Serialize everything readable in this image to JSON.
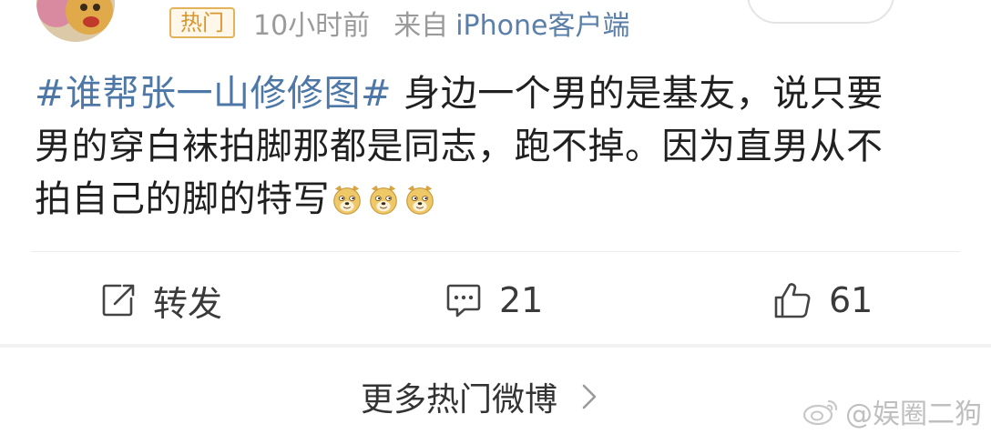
{
  "post": {
    "hot_badge": "热门",
    "time": "10小时前",
    "from_label": "来自",
    "source": "iPhone客户端",
    "topic": "#谁帮张一山修修图#",
    "line1_rest": " 身边一个男的是基友，说只要",
    "line2": "男的穿白袜拍脚那都是同志，跑不掉。因为直男从不",
    "line3": "拍自己的脚的特写",
    "emojis": [
      "doge-emoji",
      "doge-emoji",
      "doge-emoji"
    ]
  },
  "actions": {
    "repost_label": "转发",
    "comment_count": "21",
    "like_count": "61"
  },
  "more": {
    "label": "更多热门微博"
  },
  "watermark": {
    "text": "@娱圈二狗"
  },
  "colors": {
    "topic": "#4c77a6",
    "source": "#5a7fa8",
    "badge_text": "#d9952e",
    "badge_border": "#e2b35a",
    "meta_text": "#9a9a9a"
  }
}
